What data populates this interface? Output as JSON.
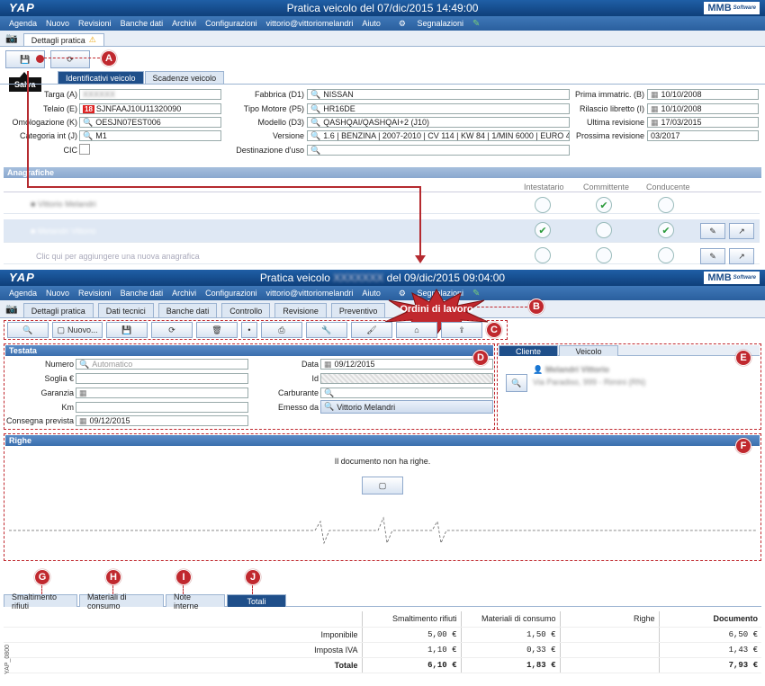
{
  "win1": {
    "title": "Pratica veicolo del 07/dic/2015 14:49:00",
    "logo": "YAP",
    "brand": "MMB",
    "brand_sub": "Software",
    "menu": [
      "Agenda",
      "Nuovo",
      "Revisioni",
      "Banche dati",
      "Archivi",
      "Configurazioni",
      "vittorio@vittoriomelandri",
      "Aiuto",
      "Segnalazioni"
    ],
    "doc_tab": "Dettagli pratica",
    "tooltip": "Salva",
    "subtabs": [
      "Identificativi veicolo",
      "Scadenze veicolo"
    ],
    "fields": {
      "targa_label": "Targa (A)",
      "telaio_label": "Telaio (E)",
      "telaio_tag": "18",
      "telaio_value": "SJNFAAJ10U11320090",
      "omologazione_label": "Omologazione (K)",
      "omologazione_value": "OESJN07EST006",
      "categoria_label": "Categoria int (J)",
      "categoria_value": "M1",
      "cic_label": "CIC",
      "fabbrica_label": "Fabbrica (D1)",
      "fabbrica_value": "NISSAN",
      "motore_label": "Tipo Motore (P5)",
      "motore_value": "HR16DE",
      "modello_label": "Modello (D3)",
      "modello_value": "QASHQAI/QASHQAI+2 (J10)",
      "versione_label": "Versione",
      "versione_value": "1.6 | BENZINA | 2007-2010 | CV 114 | KW 84 | 1/MIN 6000 | EURO 4",
      "destinazione_label": "Destinazione d'uso",
      "prima_label": "Prima immatric. (B)",
      "prima_value": "10/10/2008",
      "rilascio_label": "Rilascio libretto (I)",
      "rilascio_value": "10/10/2008",
      "ultima_label": "Ultima revisione",
      "ultima_value": "17/03/2015",
      "prossima_label": "Prossima revisione",
      "prossima_value": "03/2017"
    },
    "anagrafiche_label": "Anagrafiche",
    "anag_cols": [
      "Intestatario",
      "Committente",
      "Conducente"
    ],
    "anag_add": "Clic qui per aggiungere una nuova anagrafica"
  },
  "win2": {
    "title_left": "Pratica veicolo",
    "title_right": "del 09/dic/2015 09:04:00",
    "tabs": [
      "Dettagli pratica",
      "Dati tecnici",
      "Banche dati",
      "Controllo",
      "Revisione",
      "Preventivo"
    ],
    "ordini": "Ordini di lavoro",
    "toolbar_nuovo": "Nuovo...",
    "testata_label": "Testata",
    "numero_label": "Numero",
    "numero_placeholder": "Automatico",
    "soglia_label": "Soglia €",
    "garanzia_label": "Garanzia",
    "km_label": "Km",
    "consegna_label": "Consegna prevista",
    "consegna_value": "09/12/2015",
    "data_label": "Data",
    "data_value": "09/12/2015",
    "id_label": "Id",
    "carburante_label": "Carburante",
    "emesso_label": "Emesso da",
    "emesso_value": "Vittorio Melandri",
    "cliente_tabs": [
      "Cliente",
      "Veicolo"
    ],
    "righe_label": "Righe",
    "no_righe": "Il documento non ha righe.",
    "bottom_tabs": [
      "Smaltimento rifiuti",
      "Materiali di consumo",
      "Note interne",
      "Totali"
    ],
    "totali": {
      "headers": [
        "",
        "Smaltimento rifiuti",
        "Materiali di consumo",
        "Righe",
        "Documento"
      ],
      "rows": [
        {
          "label": "Imponibile",
          "smalt": "5,00 €",
          "mat": "1,50 €",
          "righe": "",
          "doc": "6,50 €"
        },
        {
          "label": "Imposta IVA",
          "smalt": "1,10 €",
          "mat": "0,33 €",
          "righe": "",
          "doc": "1,43 €"
        },
        {
          "label": "Totale",
          "smalt": "6,10 €",
          "mat": "1,83 €",
          "righe": "",
          "doc": "7,93 €"
        }
      ]
    },
    "side_code": "YAP_0800"
  },
  "callouts": [
    "A",
    "B",
    "C",
    "D",
    "E",
    "F",
    "G",
    "H",
    "I",
    "J"
  ],
  "colors": {
    "accent": "#1f4f8a",
    "callout": "#c0282e",
    "ok": "#2a9a3a"
  }
}
